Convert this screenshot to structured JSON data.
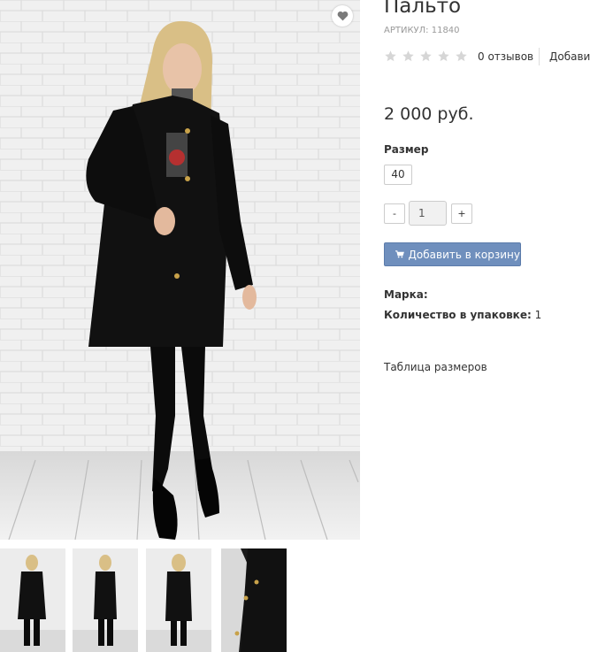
{
  "product": {
    "title": "Пальто",
    "sku": "АРТИКУЛ: 11840",
    "rating": 0,
    "rating_max": 5,
    "reviews_label": "0 отзывов",
    "add_review_label": "Добавить",
    "price": "2 000 руб."
  },
  "options": {
    "size_label": "Размер",
    "sizes": [
      "40"
    ]
  },
  "quantity": {
    "minus_label": "-",
    "value": "1",
    "plus_label": "+"
  },
  "cart": {
    "button_label": "Добавить в корзину",
    "icon": "cart-icon"
  },
  "specs": {
    "brand_label": "Марка:",
    "brand_value": "",
    "pack_label": "Количество в упаковке:",
    "pack_value": "1"
  },
  "links": {
    "size_table": "Таблица размеров"
  },
  "gallery": {
    "thumb_count": 4
  },
  "colors": {
    "accent_button": "#6f8fbd",
    "star_empty": "#d6d6d6",
    "coat": "#111111"
  }
}
